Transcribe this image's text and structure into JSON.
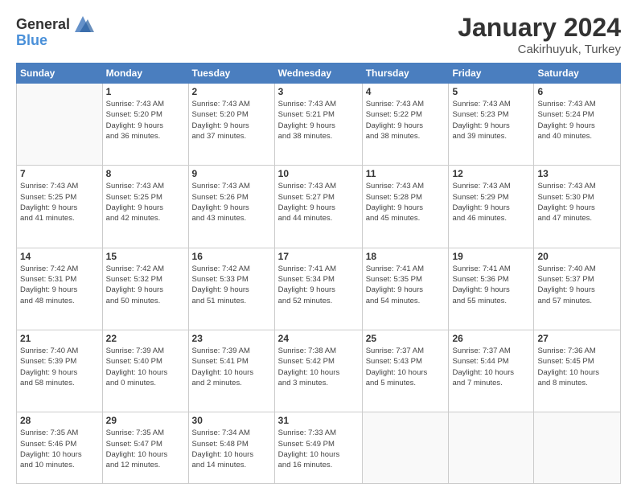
{
  "header": {
    "logo_general": "General",
    "logo_blue": "Blue",
    "month_title": "January 2024",
    "location": "Cakirhuyuk, Turkey"
  },
  "days_of_week": [
    "Sunday",
    "Monday",
    "Tuesday",
    "Wednesday",
    "Thursday",
    "Friday",
    "Saturday"
  ],
  "weeks": [
    [
      {
        "day": "",
        "info": ""
      },
      {
        "day": "1",
        "info": "Sunrise: 7:43 AM\nSunset: 5:20 PM\nDaylight: 9 hours\nand 36 minutes."
      },
      {
        "day": "2",
        "info": "Sunrise: 7:43 AM\nSunset: 5:20 PM\nDaylight: 9 hours\nand 37 minutes."
      },
      {
        "day": "3",
        "info": "Sunrise: 7:43 AM\nSunset: 5:21 PM\nDaylight: 9 hours\nand 38 minutes."
      },
      {
        "day": "4",
        "info": "Sunrise: 7:43 AM\nSunset: 5:22 PM\nDaylight: 9 hours\nand 38 minutes."
      },
      {
        "day": "5",
        "info": "Sunrise: 7:43 AM\nSunset: 5:23 PM\nDaylight: 9 hours\nand 39 minutes."
      },
      {
        "day": "6",
        "info": "Sunrise: 7:43 AM\nSunset: 5:24 PM\nDaylight: 9 hours\nand 40 minutes."
      }
    ],
    [
      {
        "day": "7",
        "info": "Sunrise: 7:43 AM\nSunset: 5:25 PM\nDaylight: 9 hours\nand 41 minutes."
      },
      {
        "day": "8",
        "info": "Sunrise: 7:43 AM\nSunset: 5:25 PM\nDaylight: 9 hours\nand 42 minutes."
      },
      {
        "day": "9",
        "info": "Sunrise: 7:43 AM\nSunset: 5:26 PM\nDaylight: 9 hours\nand 43 minutes."
      },
      {
        "day": "10",
        "info": "Sunrise: 7:43 AM\nSunset: 5:27 PM\nDaylight: 9 hours\nand 44 minutes."
      },
      {
        "day": "11",
        "info": "Sunrise: 7:43 AM\nSunset: 5:28 PM\nDaylight: 9 hours\nand 45 minutes."
      },
      {
        "day": "12",
        "info": "Sunrise: 7:43 AM\nSunset: 5:29 PM\nDaylight: 9 hours\nand 46 minutes."
      },
      {
        "day": "13",
        "info": "Sunrise: 7:43 AM\nSunset: 5:30 PM\nDaylight: 9 hours\nand 47 minutes."
      }
    ],
    [
      {
        "day": "14",
        "info": "Sunrise: 7:42 AM\nSunset: 5:31 PM\nDaylight: 9 hours\nand 48 minutes."
      },
      {
        "day": "15",
        "info": "Sunrise: 7:42 AM\nSunset: 5:32 PM\nDaylight: 9 hours\nand 50 minutes."
      },
      {
        "day": "16",
        "info": "Sunrise: 7:42 AM\nSunset: 5:33 PM\nDaylight: 9 hours\nand 51 minutes."
      },
      {
        "day": "17",
        "info": "Sunrise: 7:41 AM\nSunset: 5:34 PM\nDaylight: 9 hours\nand 52 minutes."
      },
      {
        "day": "18",
        "info": "Sunrise: 7:41 AM\nSunset: 5:35 PM\nDaylight: 9 hours\nand 54 minutes."
      },
      {
        "day": "19",
        "info": "Sunrise: 7:41 AM\nSunset: 5:36 PM\nDaylight: 9 hours\nand 55 minutes."
      },
      {
        "day": "20",
        "info": "Sunrise: 7:40 AM\nSunset: 5:37 PM\nDaylight: 9 hours\nand 57 minutes."
      }
    ],
    [
      {
        "day": "21",
        "info": "Sunrise: 7:40 AM\nSunset: 5:39 PM\nDaylight: 9 hours\nand 58 minutes."
      },
      {
        "day": "22",
        "info": "Sunrise: 7:39 AM\nSunset: 5:40 PM\nDaylight: 10 hours\nand 0 minutes."
      },
      {
        "day": "23",
        "info": "Sunrise: 7:39 AM\nSunset: 5:41 PM\nDaylight: 10 hours\nand 2 minutes."
      },
      {
        "day": "24",
        "info": "Sunrise: 7:38 AM\nSunset: 5:42 PM\nDaylight: 10 hours\nand 3 minutes."
      },
      {
        "day": "25",
        "info": "Sunrise: 7:37 AM\nSunset: 5:43 PM\nDaylight: 10 hours\nand 5 minutes."
      },
      {
        "day": "26",
        "info": "Sunrise: 7:37 AM\nSunset: 5:44 PM\nDaylight: 10 hours\nand 7 minutes."
      },
      {
        "day": "27",
        "info": "Sunrise: 7:36 AM\nSunset: 5:45 PM\nDaylight: 10 hours\nand 8 minutes."
      }
    ],
    [
      {
        "day": "28",
        "info": "Sunrise: 7:35 AM\nSunset: 5:46 PM\nDaylight: 10 hours\nand 10 minutes."
      },
      {
        "day": "29",
        "info": "Sunrise: 7:35 AM\nSunset: 5:47 PM\nDaylight: 10 hours\nand 12 minutes."
      },
      {
        "day": "30",
        "info": "Sunrise: 7:34 AM\nSunset: 5:48 PM\nDaylight: 10 hours\nand 14 minutes."
      },
      {
        "day": "31",
        "info": "Sunrise: 7:33 AM\nSunset: 5:49 PM\nDaylight: 10 hours\nand 16 minutes."
      },
      {
        "day": "",
        "info": ""
      },
      {
        "day": "",
        "info": ""
      },
      {
        "day": "",
        "info": ""
      }
    ]
  ]
}
